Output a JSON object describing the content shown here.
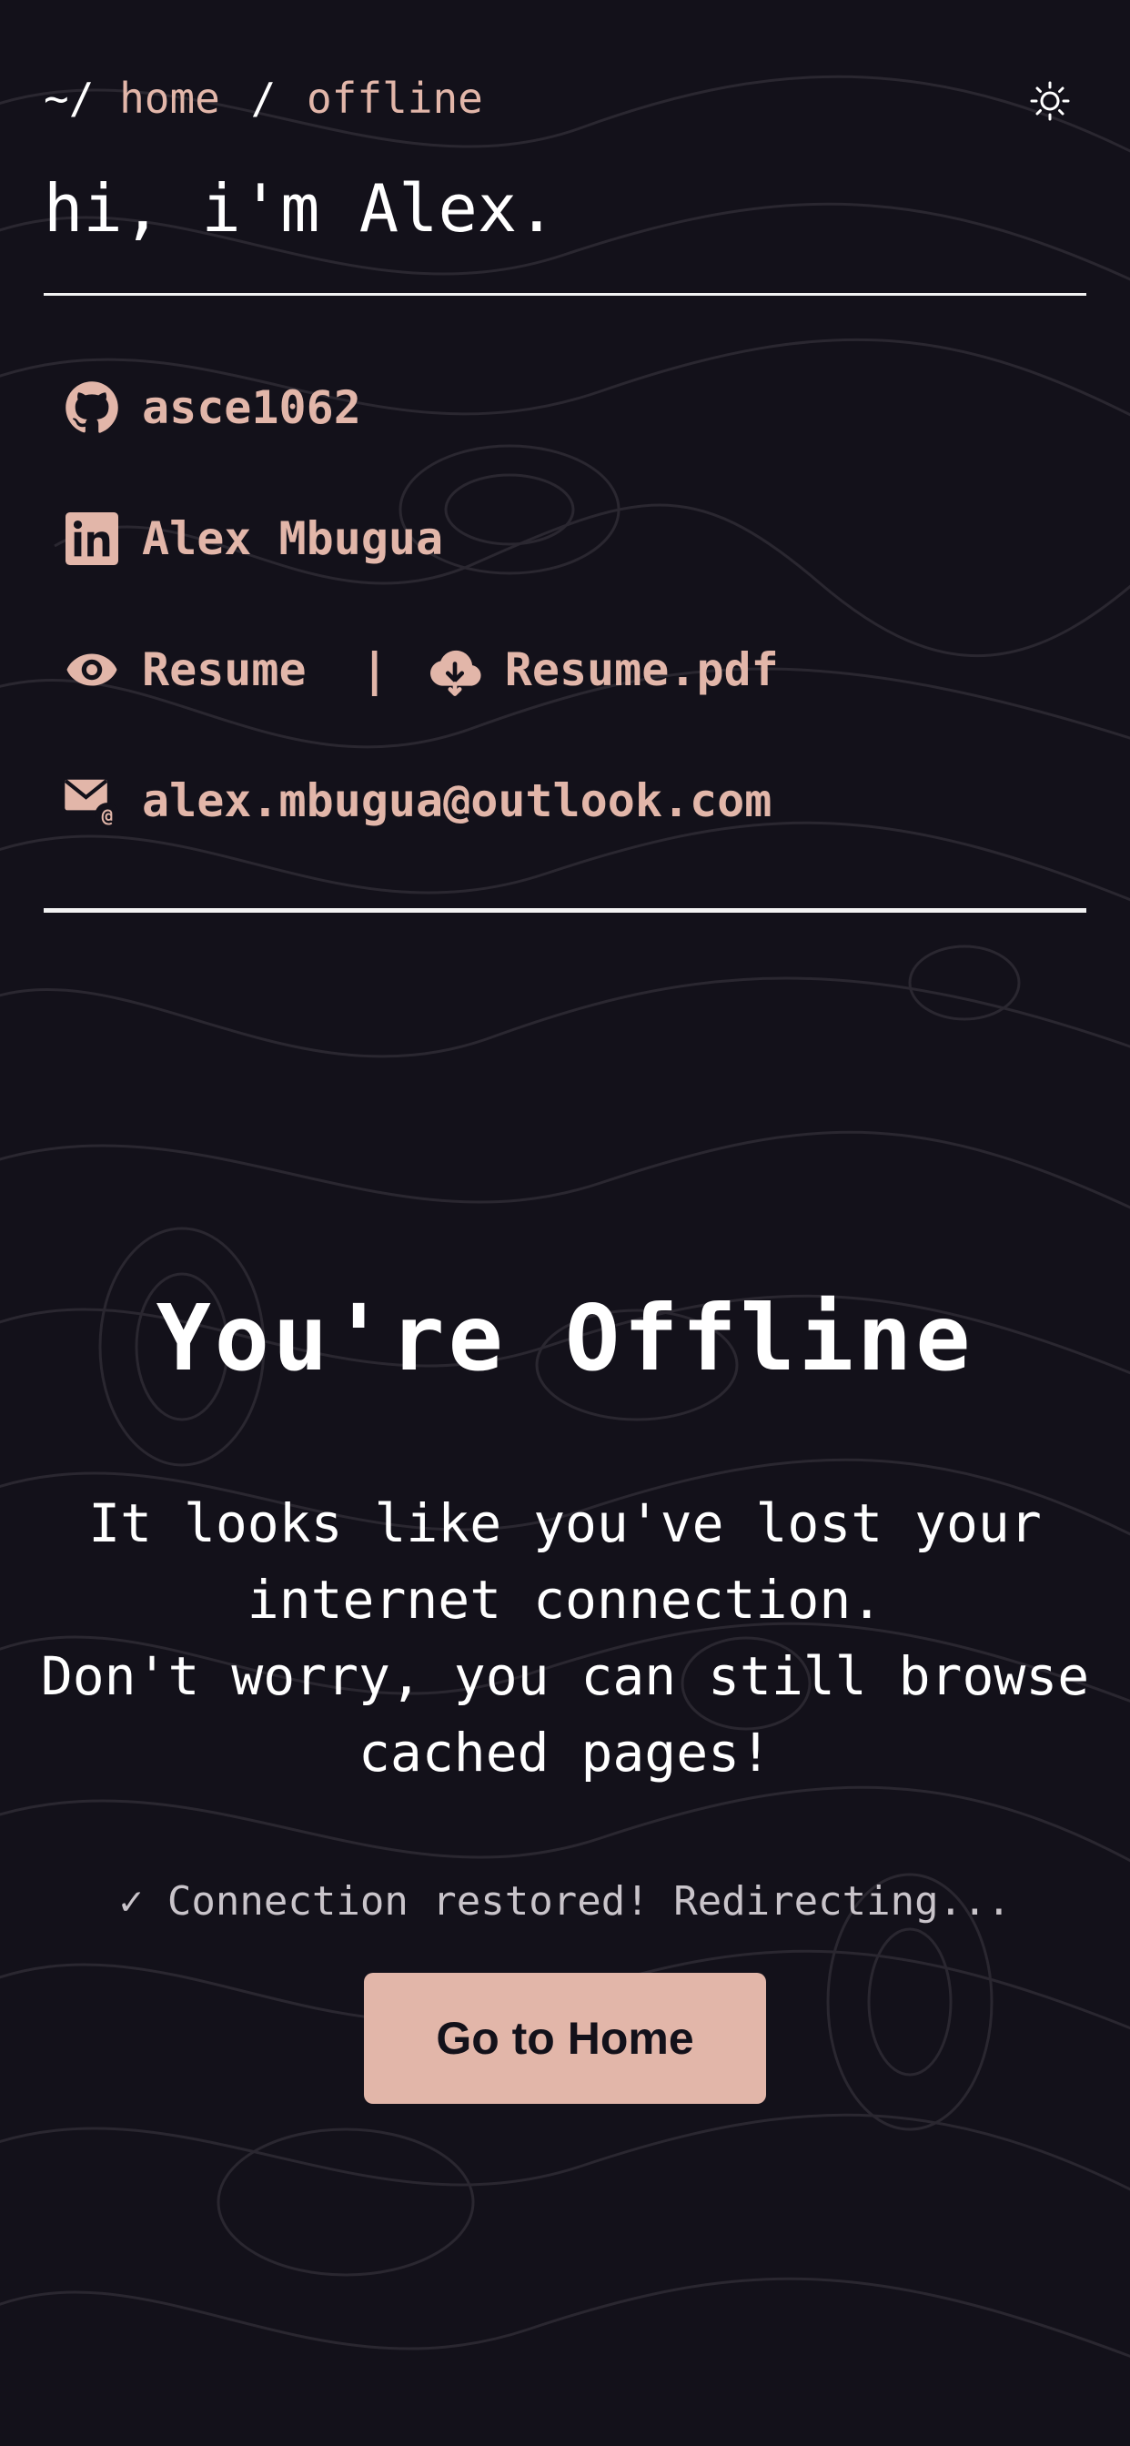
{
  "header": {
    "breadcrumb_root": "~/",
    "breadcrumb_sep_1": "/",
    "breadcrumb_home": "home",
    "breadcrumb_current": "offline",
    "theme_toggle_icon": "sun-icon"
  },
  "greeting": "hi, i'm Alex.",
  "contacts": {
    "github": {
      "icon": "github-icon",
      "label": "asce1062"
    },
    "linkedin": {
      "icon": "linkedin-icon",
      "label": "Alex Mbugua"
    },
    "resume_view": {
      "icon": "eye-icon",
      "label": "Resume"
    },
    "resume_divider": "|",
    "resume_download": {
      "icon": "cloud-download-icon",
      "label": "Resume.pdf"
    },
    "email": {
      "icon": "email-icon",
      "label": "alex.mbugua@outlook.com"
    }
  },
  "offline": {
    "title": "You're Offline",
    "message_line_1": "It looks like you've lost your internet connection.",
    "message_line_2": "Don't worry, you can still browse cached pages!",
    "status": "✓ Connection restored! Redirecting...",
    "button_label": "Go to Home"
  },
  "colors": {
    "background": "#13111a",
    "accent": "#e2b6a9",
    "text": "#ffffff",
    "muted": "#c9c4ca",
    "contour": "#2a2730"
  }
}
